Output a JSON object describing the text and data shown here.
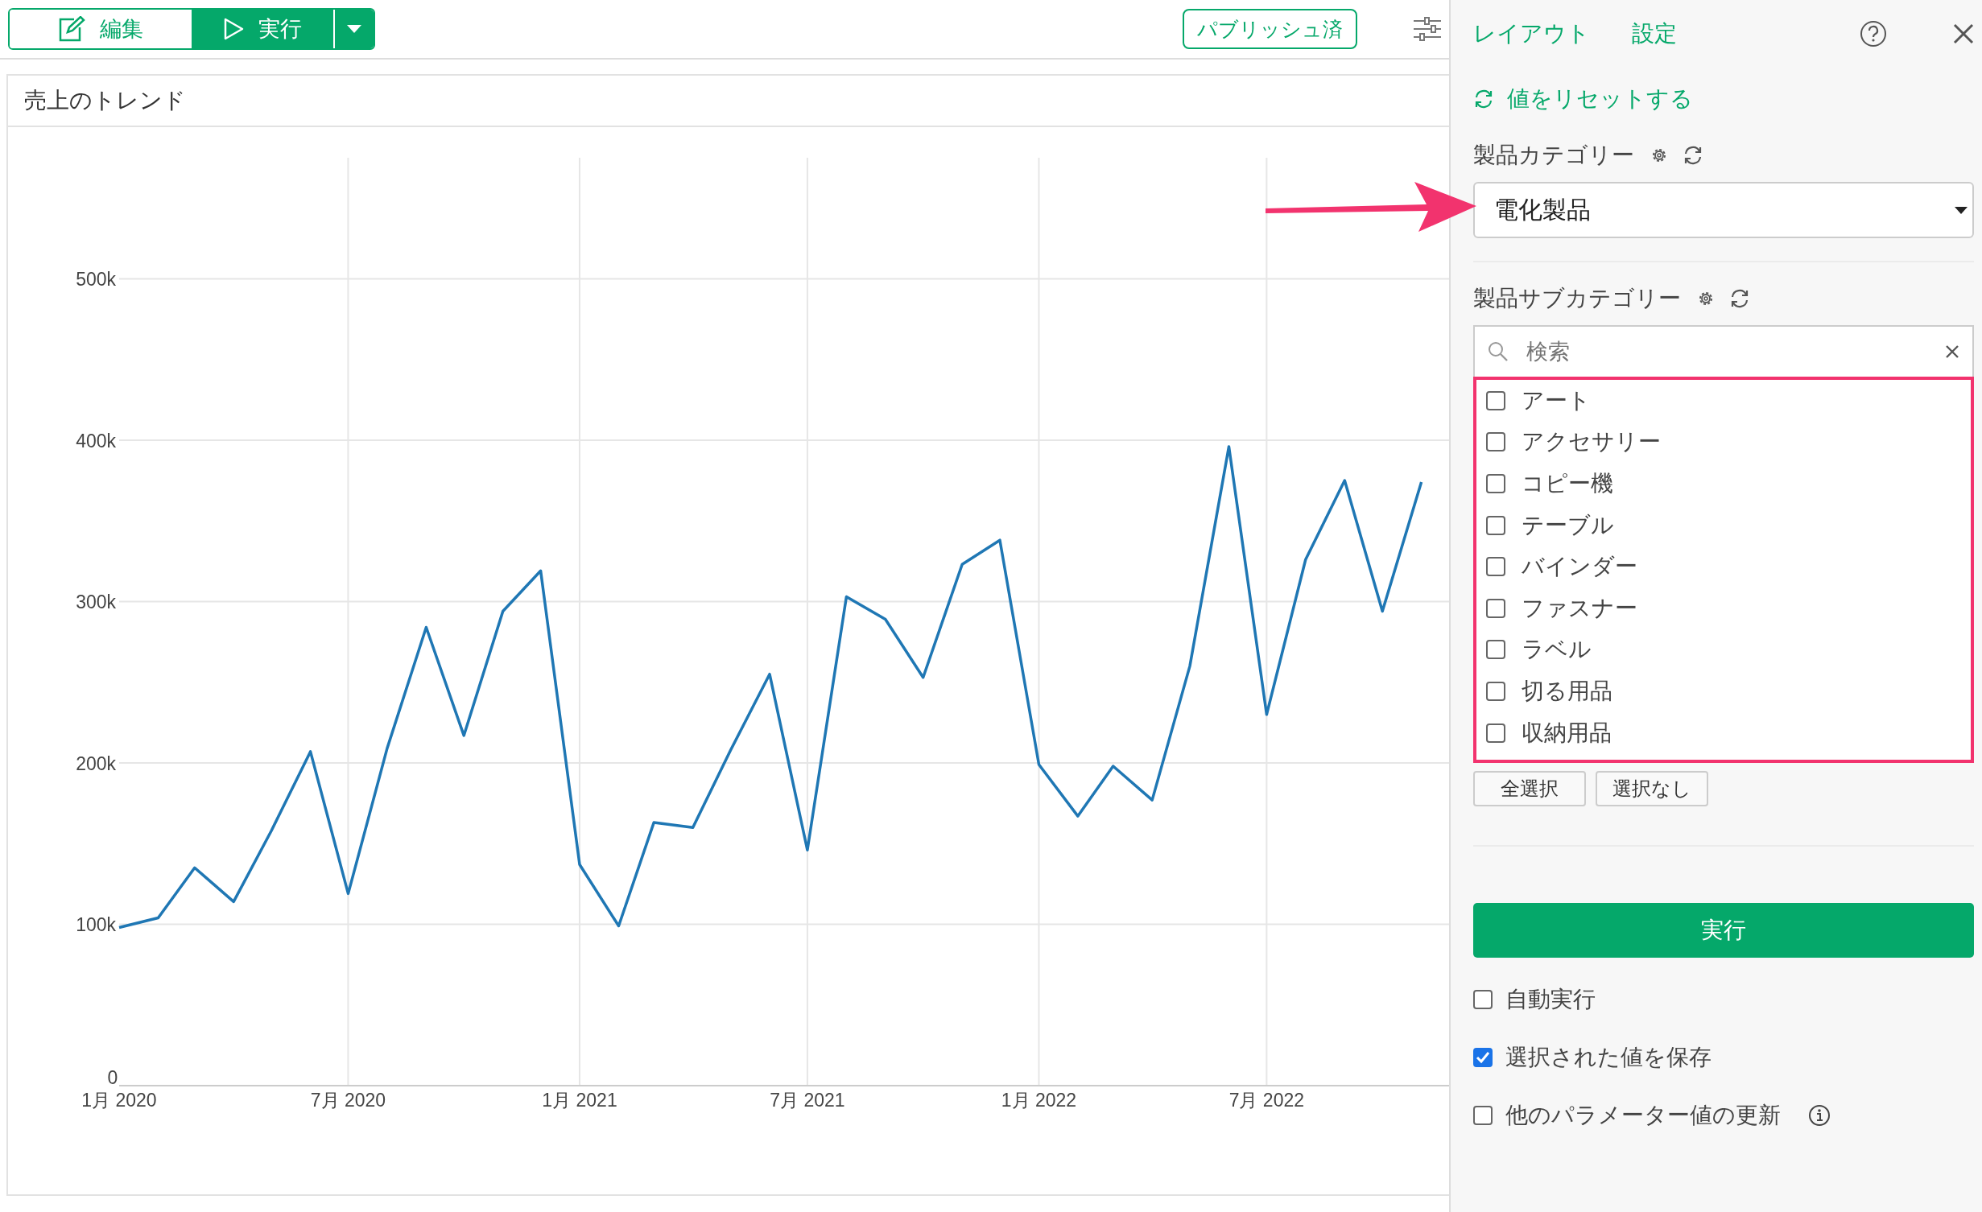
{
  "toolbar": {
    "edit_button": "編集",
    "run_button": "実行",
    "publish_button": "パブリッシュ済"
  },
  "chart": {
    "title": "売上のトレンド",
    "chart_data": {
      "type": "line",
      "x": [
        "2020-01",
        "2020-02",
        "2020-03",
        "2020-04",
        "2020-05",
        "2020-06",
        "2020-07",
        "2020-08",
        "2020-09",
        "2020-10",
        "2020-11",
        "2020-12",
        "2021-01",
        "2021-02",
        "2021-03",
        "2021-04",
        "2021-05",
        "2021-06",
        "2021-07",
        "2021-08",
        "2021-09",
        "2021-10",
        "2021-11",
        "2021-12",
        "2022-01",
        "2022-02",
        "2022-03",
        "2022-04",
        "2022-05",
        "2022-06",
        "2022-07",
        "2022-08",
        "2022-09",
        "2022-10",
        "2022-11"
      ],
      "series": [
        {
          "color": "#1f77b4",
          "values": [
            98000,
            104000,
            135000,
            114000,
            158000,
            207000,
            119000,
            209000,
            284000,
            217000,
            294000,
            319000,
            137000,
            99000,
            163000,
            160000,
            208000,
            255000,
            146000,
            303000,
            289000,
            253000,
            323000,
            338000,
            199000,
            167000,
            198000,
            177000,
            260000,
            396000,
            230000,
            326000,
            375000,
            294000,
            374000
          ]
        }
      ],
      "xlim": [
        "2020-01-01",
        "2022-11-23"
      ],
      "ylim": [
        0,
        575000
      ],
      "grid": true,
      "xticks": [
        {
          "value": "2020-01",
          "label": "1月 2020"
        },
        {
          "value": "2020-07",
          "label": "7月 2020"
        },
        {
          "value": "2021-01",
          "label": "1月 2021"
        },
        {
          "value": "2021-07",
          "label": "7月 2021"
        },
        {
          "value": "2022-01",
          "label": "1月 2022"
        },
        {
          "value": "2022-07",
          "label": "7月 2022"
        }
      ],
      "yticks": [
        {
          "value": 0,
          "label": "0"
        },
        {
          "value": 100000,
          "label": "100k"
        },
        {
          "value": 200000,
          "label": "200k"
        },
        {
          "value": 300000,
          "label": "300k"
        },
        {
          "value": 400000,
          "label": "400k"
        },
        {
          "value": 500000,
          "label": "500k"
        }
      ]
    }
  },
  "panel": {
    "tabs": [
      {
        "label": "レイアウト"
      },
      {
        "label": "設定"
      }
    ],
    "reset_link": "値をリセットする",
    "parameters": [
      {
        "kind": "dropdown",
        "label": "製品カテゴリー",
        "value": "電化製品"
      },
      {
        "kind": "checklist",
        "label": "製品サブカテゴリー",
        "placeholder": "検索",
        "options": [
          {
            "label": "アート",
            "checked": false
          },
          {
            "label": "アクセサリー",
            "checked": false
          },
          {
            "label": "コピー機",
            "checked": false
          },
          {
            "label": "テーブル",
            "checked": false
          },
          {
            "label": "バインダー",
            "checked": false
          },
          {
            "label": "ファスナー",
            "checked": false
          },
          {
            "label": "ラベル",
            "checked": false
          },
          {
            "label": "切る用品",
            "checked": false
          },
          {
            "label": "収納用品",
            "checked": false
          }
        ],
        "buttons": [
          "全選択",
          "選択なし"
        ]
      }
    ],
    "run_button": "実行",
    "options": [
      {
        "label": "自動実行",
        "checked": false,
        "info": false
      },
      {
        "label": "選択された値を保存",
        "checked": true,
        "info": false
      },
      {
        "label": "他のパラメーター値の更新",
        "checked": false,
        "info": true
      }
    ]
  }
}
